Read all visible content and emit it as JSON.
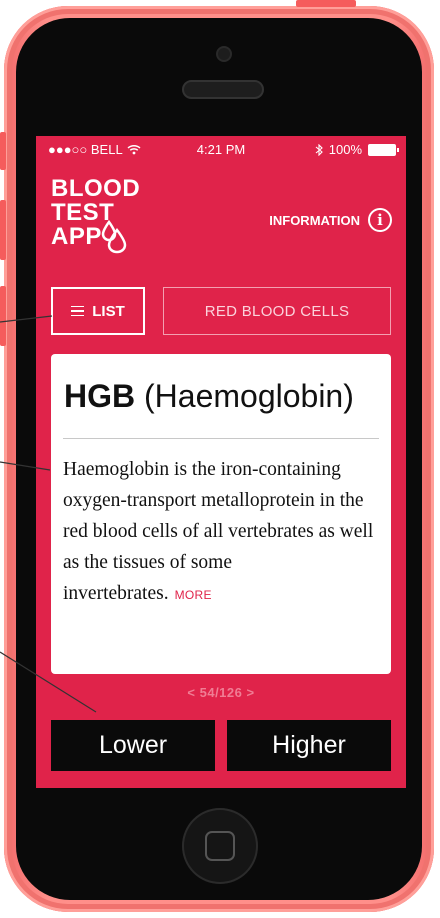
{
  "status_bar": {
    "carrier": "●●●○○ BELL",
    "time": "4:21 PM",
    "battery": "100%"
  },
  "logo": {
    "line1": "BLOOD",
    "line2": "TEST",
    "line3": "APP"
  },
  "header": {
    "information_label": "INFORMATION",
    "info_glyph": "i"
  },
  "nav": {
    "list_label": "LIST",
    "category_label": "RED BLOOD CELLS"
  },
  "card": {
    "abbreviation": "HGB",
    "full_name": "(Haemoglobin)",
    "description": "Haemoglobin is the iron-containing oxygen-transport metalloprotein in the red blood cells of all vertebrates as well as the tissues of some invertebrates.",
    "more_label": "MORE"
  },
  "pager": {
    "text": "< 54/126 >",
    "current": 54,
    "total": 126
  },
  "actions": {
    "lower_label": "Lower",
    "higher_label": "Higher"
  },
  "colors": {
    "accent": "#e0234a",
    "phone_shell": "#ff8f8a",
    "button_dark": "#0a0a0a"
  },
  "icons": [
    "wifi-icon",
    "bluetooth-icon",
    "battery-icon",
    "blood-drop-icon",
    "info-icon",
    "menu-icon"
  ]
}
